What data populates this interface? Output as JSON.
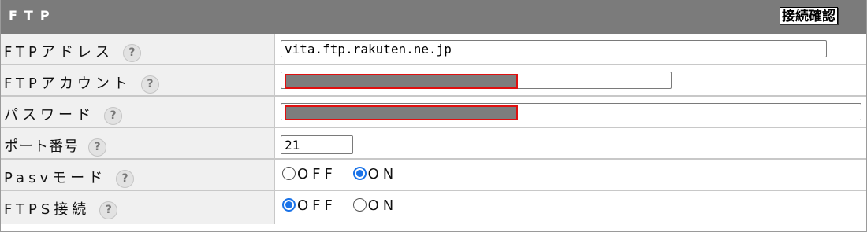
{
  "header": {
    "title": "FTP",
    "connect_button": "接続確認"
  },
  "help_icon_glyph": "?",
  "rows": {
    "address": {
      "label": "FTPアドレス",
      "value": "vita.ftp.rakuten.ne.jp"
    },
    "account": {
      "label": "FTPアカウント",
      "value": ""
    },
    "password": {
      "label": "パスワード",
      "value": ""
    },
    "port": {
      "label": "ポート番号",
      "value": "21"
    },
    "pasv": {
      "label": "Pasvモード",
      "options": [
        "OFF",
        "ON"
      ],
      "selected": "ON"
    },
    "ftps": {
      "label": "FTPS接続",
      "options": [
        "OFF",
        "ON"
      ],
      "selected": "OFF"
    }
  },
  "colors": {
    "header_bg": "#7b7b7b",
    "label_bg": "#f0f0f0",
    "redaction_border": "#e01010",
    "radio_accent": "#1a73e8"
  }
}
